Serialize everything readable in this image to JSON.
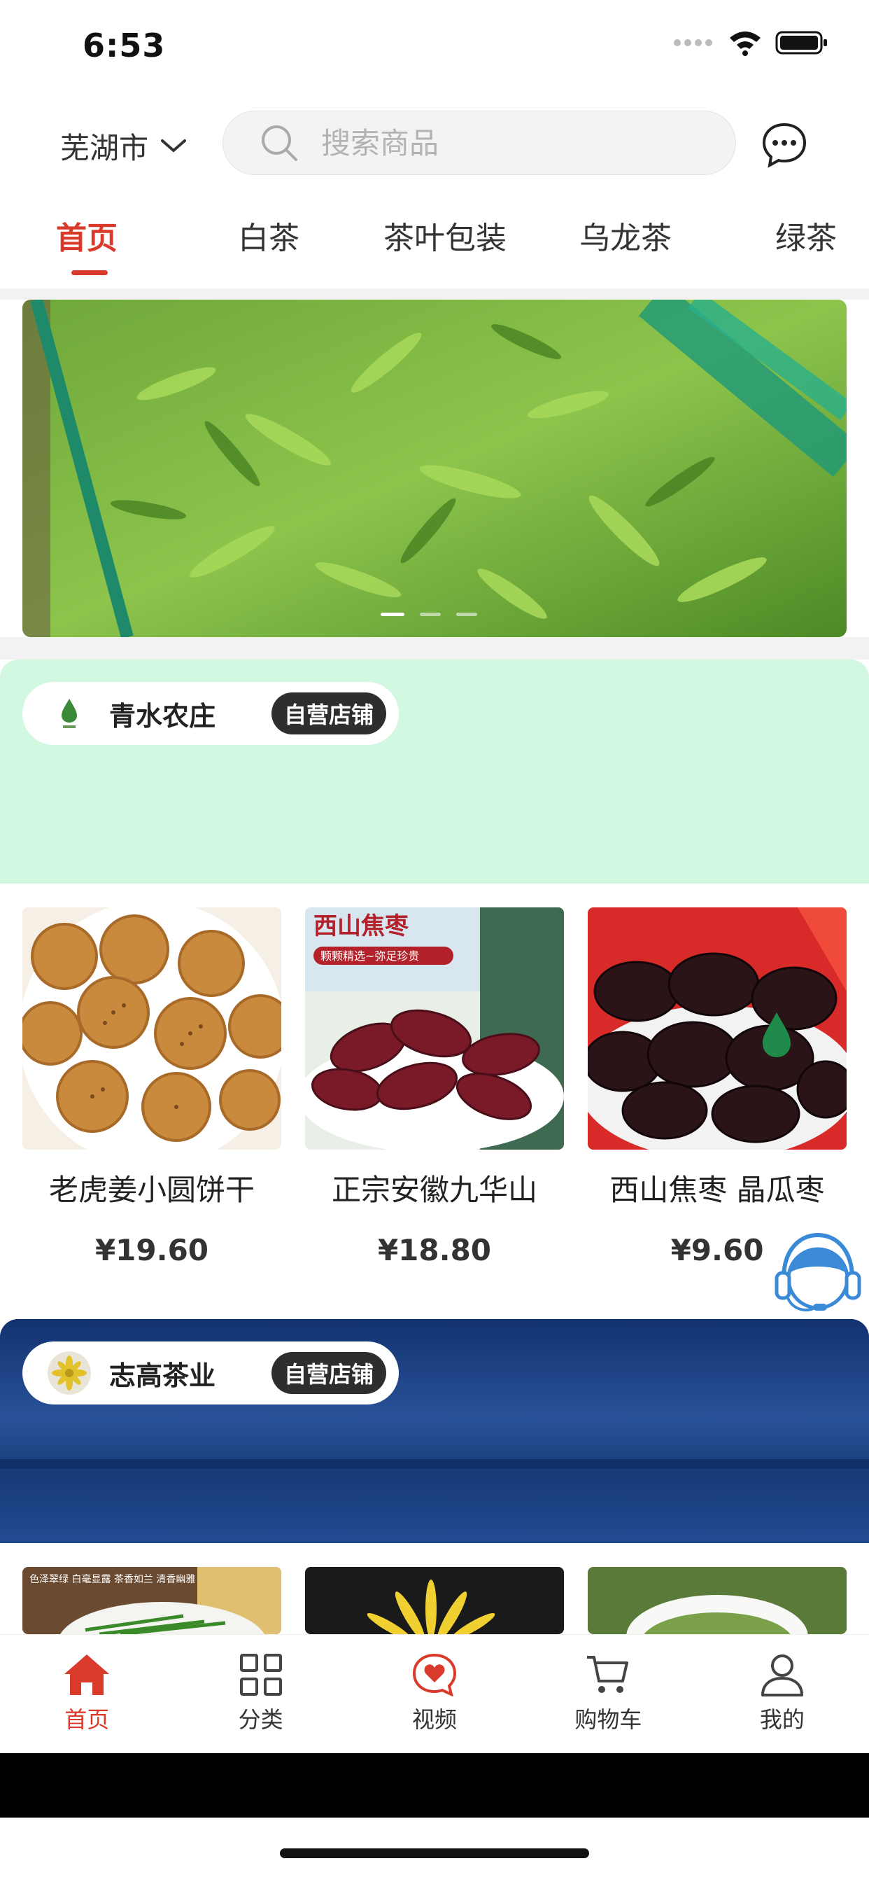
{
  "status_bar": {
    "time": "6:53"
  },
  "header": {
    "city": "芜湖市",
    "search_placeholder": "搜索商品"
  },
  "tabs": [
    {
      "label": "首页",
      "active": true
    },
    {
      "label": "白茶"
    },
    {
      "label": "茶叶包装"
    },
    {
      "label": "乌龙茶"
    },
    {
      "label": "绿茶"
    }
  ],
  "banner": {
    "dots": 3,
    "active_dot": 0
  },
  "shops": [
    {
      "name": "青水农庄",
      "badge": "自营店铺",
      "bg_color": "#d2f8e2",
      "products": [
        {
          "name": "老虎姜小圆饼干",
          "price": "¥19.60"
        },
        {
          "name": "正宗安徽九华山",
          "price": "¥18.80"
        },
        {
          "name": "西山焦枣 晶瓜枣",
          "price": "¥9.60",
          "image_text": "西山焦枣",
          "image_subtext": "颗颗精选~弥足珍贵"
        }
      ]
    },
    {
      "name": "志高茶业",
      "badge": "自营店铺",
      "bg_color": "#1d3f80",
      "products": [
        {
          "image_text": "色泽翠绿 白毫显露\n茶香如兰 清香幽雅"
        },
        {},
        {}
      ]
    }
  ],
  "bottom_nav": [
    {
      "label": "首页",
      "icon": "home-icon",
      "active": true
    },
    {
      "label": "分类",
      "icon": "grid-icon"
    },
    {
      "label": "视频",
      "icon": "heart-chat-icon"
    },
    {
      "label": "购物车",
      "icon": "cart-icon"
    },
    {
      "label": "我的",
      "icon": "user-icon"
    }
  ],
  "colors": {
    "accent": "#d93a2c",
    "shop1_bg": "#d2f8e2",
    "shop2_bg": "#1d3f80"
  }
}
